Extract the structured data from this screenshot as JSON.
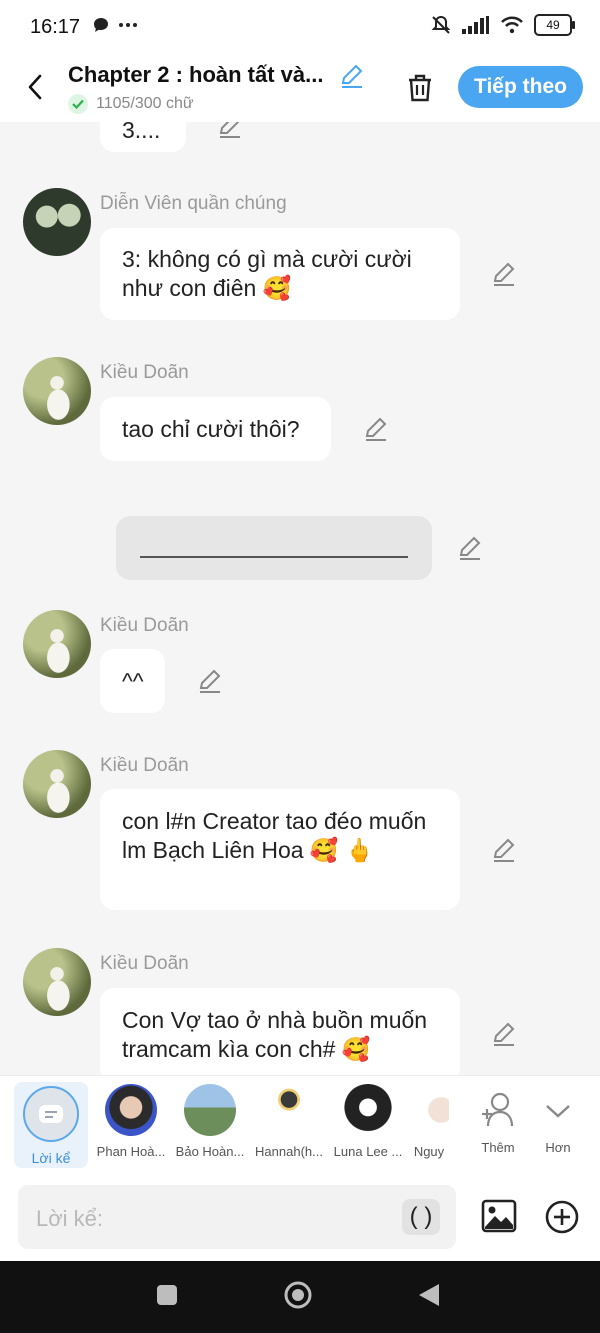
{
  "status": {
    "time": "16:17",
    "battery": "49"
  },
  "header": {
    "title": "Chapter 2 : hoàn tất và...",
    "word_count": "1105/300 chữ",
    "next_button": "Tiếp theo"
  },
  "messages": [
    {
      "type": "partial",
      "text": "3...."
    },
    {
      "type": "dialogue",
      "speaker": "Diễn Viên quần chúng",
      "text": "3: không có gì mà cười cười như con điên 🥰"
    },
    {
      "type": "dialogue",
      "speaker": "Kiều Doãn",
      "text": "tao chỉ cười thôi?"
    },
    {
      "type": "narration",
      "text": ""
    },
    {
      "type": "dialogue",
      "speaker": "Kiều Doãn",
      "text": "^^"
    },
    {
      "type": "dialogue",
      "speaker": "Kiều Doãn",
      "text": "con l#n Creator tao đéo muốn lm Bạch Liên Hoa 🥰 🖕"
    },
    {
      "type": "dialogue",
      "speaker": "Kiều Doãn",
      "text": "Con Vợ tao ở nhà buồn muốn tramcam kìa con ch# 🥰"
    }
  ],
  "characters": {
    "narrator_label": "Lời kể",
    "items": [
      {
        "label": "Phan Hoà..."
      },
      {
        "label": "Bảo Hoàn..."
      },
      {
        "label": "Hannah(h..."
      },
      {
        "label": "Luna Lee ..."
      },
      {
        "label": "Nguy"
      }
    ],
    "add_label": "Thêm",
    "more_label": "Hơn"
  },
  "input": {
    "placeholder": "Lời kể:",
    "paren_label": "( )"
  },
  "colors": {
    "accent": "#4aa6f0",
    "background": "#f5f5f5"
  }
}
